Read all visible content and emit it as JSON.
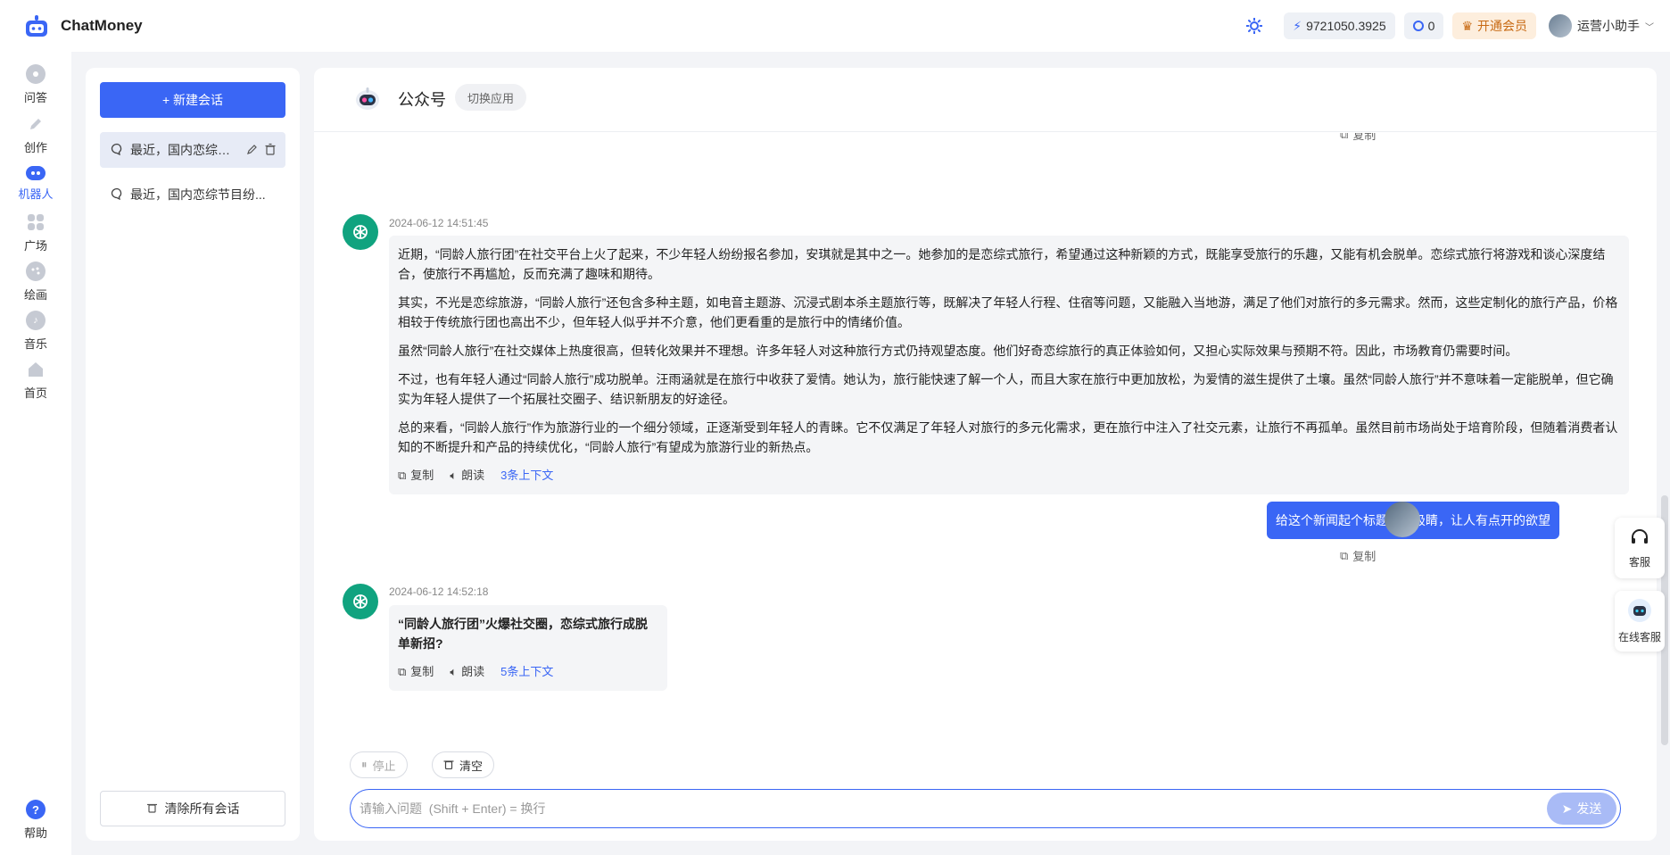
{
  "app": {
    "name": "ChatMoney"
  },
  "topbar": {
    "balance": "9721050.3925",
    "tokens": "0",
    "vip_label": "开通会员",
    "username": "运营小助手"
  },
  "nav": [
    {
      "label": "问答"
    },
    {
      "label": "创作"
    },
    {
      "label": "机器人"
    },
    {
      "label": "广场"
    },
    {
      "label": "绘画"
    },
    {
      "label": "音乐"
    },
    {
      "label": "首页"
    }
  ],
  "help_label": "帮助",
  "sidebar": {
    "new_chat": "+ 新建会话",
    "conversations": [
      {
        "title": "最近，国内恋综节..."
      },
      {
        "title": "最近，国内恋综节目纷..."
      }
    ],
    "clear_all": "清除所有会话"
  },
  "chat": {
    "title": "公众号",
    "switch_app": "切换应用",
    "top_copy": "复制",
    "messages": [
      {
        "time": "2024-06-12 14:51:45",
        "paragraphs": [
          "近期，“同龄人旅行团”在社交平台上火了起来，不少年轻人纷纷报名参加，安琪就是其中之一。她参加的是恋综式旅行，希望通过这种新颖的方式，既能享受旅行的乐趣，又能有机会脱单。恋综式旅行将游戏和谈心深度结合，使旅行不再尴尬，反而充满了趣味和期待。",
          "其实，不光是恋综旅游，“同龄人旅行”还包含多种主题，如电音主题游、沉浸式剧本杀主题旅行等，既解决了年轻人行程、住宿等问题，又能融入当地游，满足了他们对旅行的多元需求。然而，这些定制化的旅行产品，价格相较于传统旅行团也高出不少，但年轻人似乎并不介意，他们更看重的是旅行中的情绪价值。",
          "虽然“同龄人旅行”在社交媒体上热度很高，但转化效果并不理想。许多年轻人对这种旅行方式仍持观望态度。他们好奇恋综旅行的真正体验如何，又担心实际效果与预期不符。因此，市场教育仍需要时间。",
          "不过，也有年轻人通过“同龄人旅行”成功脱单。汪雨涵就是在旅行中收获了爱情。她认为，旅行能快速了解一个人，而且大家在旅行中更加放松，为爱情的滋生提供了土壤。虽然“同龄人旅行”并不意味着一定能脱单，但它确实为年轻人提供了一个拓展社交圈子、结识新朋友的好途径。",
          "总的来看，“同龄人旅行”作为旅游行业的一个细分领域，正逐渐受到年轻人的青睐。它不仅满足了年轻人对旅行的多元化需求，更在旅行中注入了社交元素，让旅行不再孤单。虽然目前市场尚处于培育阶段，但随着消费者认知的不断提升和产品的持续优化，“同龄人旅行”有望成为旅游行业的新热点。"
        ],
        "copy": "复制",
        "read": "朗读",
        "context": "3条上下文"
      },
      {
        "user_text": "给这个新闻起个标题，要吸睛，让人有点开的欲望",
        "copy": "复制"
      },
      {
        "time": "2024-06-12 14:52:18",
        "answer": "“同龄人旅行团”火爆社交圈，恋综式旅行成脱单新招?",
        "copy": "复制",
        "read": "朗读",
        "context": "5条上下文"
      }
    ],
    "stop": "停止",
    "clear": "清空",
    "input_placeholder": "请输入问题  (Shift + Enter) = 换行",
    "send": "发送"
  },
  "float": {
    "service": "客服",
    "online_service": "在线客服"
  },
  "colors": {
    "accent": "#3a66f5",
    "gpt": "#10a37f"
  }
}
